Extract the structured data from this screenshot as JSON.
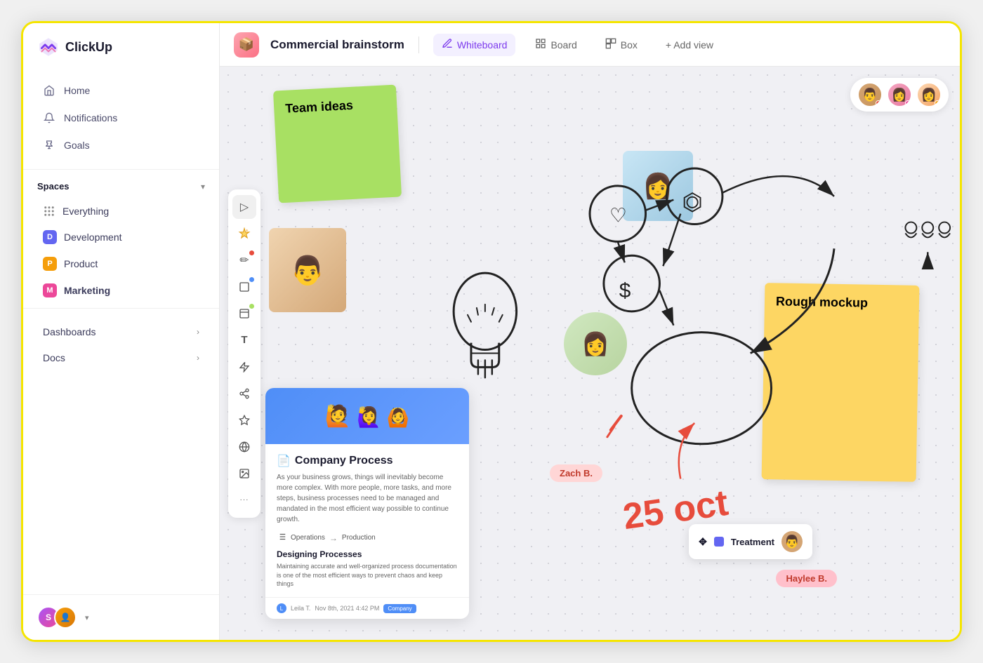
{
  "app": {
    "name": "ClickUp",
    "logo_text": "ClickUp"
  },
  "sidebar": {
    "nav_items": [
      {
        "id": "home",
        "label": "Home",
        "icon": "home"
      },
      {
        "id": "notifications",
        "label": "Notifications",
        "icon": "bell"
      },
      {
        "id": "goals",
        "label": "Goals",
        "icon": "trophy"
      }
    ],
    "spaces_label": "Spaces",
    "spaces": [
      {
        "id": "everything",
        "label": "Everything",
        "icon": "dots",
        "color": null
      },
      {
        "id": "development",
        "label": "Development",
        "badge": "D",
        "color": "#6366f1"
      },
      {
        "id": "product",
        "label": "Product",
        "badge": "P",
        "color": "#f59e0b"
      },
      {
        "id": "marketing",
        "label": "Marketing",
        "badge": "M",
        "color": "#ec4899",
        "bold": true
      }
    ],
    "dashboards_label": "Dashboards",
    "docs_label": "Docs"
  },
  "topbar": {
    "project_title": "Commercial brainstorm",
    "views": [
      {
        "id": "whiteboard",
        "label": "Whiteboard",
        "active": true,
        "icon": "✏️"
      },
      {
        "id": "board",
        "label": "Board",
        "active": false,
        "icon": "⊞"
      },
      {
        "id": "box",
        "label": "Box",
        "active": false,
        "icon": "⊟"
      }
    ],
    "add_view_label": "+ Add view"
  },
  "whiteboard": {
    "sticky_green_text": "Team ideas",
    "sticky_yellow_text": "Rough mockup",
    "doc_title": "Company Process",
    "doc_desc": "As your business grows, things will inevitably become more complex. With more people, more tasks, and more steps, business processes need to be managed and mandated in the most efficient way possible to continue growth.",
    "doc_from": "Operations",
    "doc_to": "Production",
    "doc_section_title": "Designing Processes",
    "doc_section_desc": "Maintaining accurate and well-organized process documentation is one of the most efficient ways to prevent chaos and keep things",
    "doc_author": "Leila T.",
    "doc_date": "Nov 8th, 2021 4:42 PM",
    "doc_badge": "Company",
    "person_label_zach": "Zach B.",
    "person_label_haylee": "Haylee B.",
    "oct_text": "25 oct",
    "treatment_label": "Treatment"
  },
  "toolbar": {
    "tools": [
      {
        "id": "cursor",
        "icon": "▷",
        "dot_color": null
      },
      {
        "id": "sparkle",
        "icon": "✦",
        "dot_color": null
      },
      {
        "id": "pen",
        "icon": "✏",
        "dot_color": "#e74c3c"
      },
      {
        "id": "square",
        "icon": "□",
        "dot_color": "#4f8ef7"
      },
      {
        "id": "note",
        "icon": "📄",
        "dot_color": "#a8e063"
      },
      {
        "id": "text",
        "icon": "T",
        "dot_color": null
      },
      {
        "id": "lightning",
        "icon": "⚡",
        "dot_color": null
      },
      {
        "id": "share",
        "icon": "⎇",
        "dot_color": null
      },
      {
        "id": "star",
        "icon": "✦",
        "dot_color": null
      },
      {
        "id": "globe",
        "icon": "🌐",
        "dot_color": null
      },
      {
        "id": "image",
        "icon": "🖼",
        "dot_color": null
      },
      {
        "id": "more",
        "icon": "•••",
        "dot_color": null
      }
    ]
  },
  "colors": {
    "accent_purple": "#7c3aed",
    "accent_blue": "#4f8ef7",
    "sticky_green": "#a8e063",
    "sticky_yellow": "#fdd663",
    "label_pink": "#ffc0cb",
    "label_red": "#ffd6d6",
    "oct_red": "#e74c3c"
  }
}
